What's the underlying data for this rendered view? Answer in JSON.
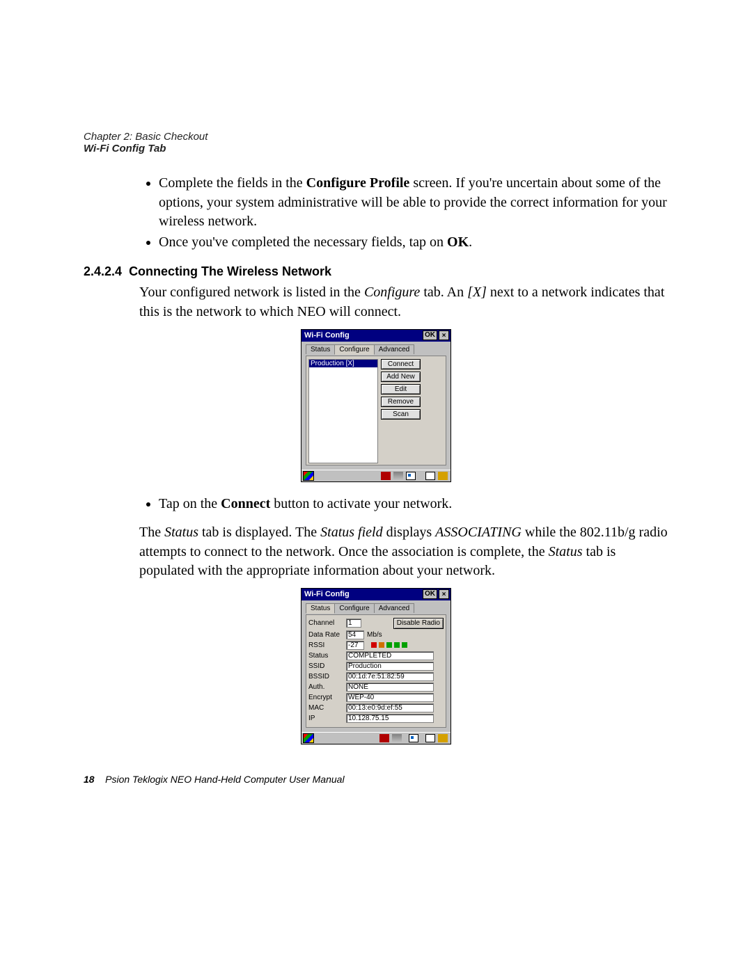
{
  "header": {
    "chapter": "Chapter 2: Basic Checkout",
    "sub": "Wi-Fi Config Tab"
  },
  "bullets_intro": {
    "b1_pre": "Complete the fields in the ",
    "b1_bold": "Configure Profile",
    "b1_post": " screen. If you're uncertain about some of the options, your system administrative will be able to provide the correct information for your wireless network.",
    "b2_pre": "Once you've completed the necessary fields, tap on ",
    "b2_bold": "OK",
    "b2_post": "."
  },
  "section": {
    "num": "2.4.2.4",
    "title": "Connecting The Wireless Network"
  },
  "para1": {
    "a": "Your configured network is listed in the ",
    "i1": "Configure",
    "b": " tab. An ",
    "i2": "[X]",
    "c": " next to a network indicates that this is the network to which NEO will connect."
  },
  "configure_dialog": {
    "title": "Wi-Fi Config",
    "ok": "OK",
    "tabs": [
      "Status",
      "Configure",
      "Advanced"
    ],
    "list_item": "Production [X]",
    "buttons": [
      "Connect",
      "Add New",
      "Edit",
      "Remove",
      "Scan"
    ]
  },
  "bullet_connect": {
    "pre": "Tap on the ",
    "bold": "Connect",
    "post": " button to activate your network."
  },
  "para2": {
    "a": "The ",
    "i1": "Status",
    "b": " tab is displayed. The ",
    "i2": "Status field",
    "c": " displays ",
    "i3": "ASSOCIATING",
    "d": " while the 802.11b/g radio attempts to connect to the network. Once the association is complete, the ",
    "i4": "Status",
    "e": " tab is populated with the appropriate information about your network."
  },
  "status_dialog": {
    "title": "Wi-Fi Config",
    "ok": "OK",
    "tabs": [
      "Status",
      "Configure",
      "Advanced"
    ],
    "disable_btn": "Disable Radio",
    "rows": {
      "channel_label": "Channel",
      "channel_val": "1",
      "rate_label": "Data Rate",
      "rate_val": "54",
      "rate_unit": "Mb/s",
      "rssi_label": "RSSI",
      "rssi_val": "-27",
      "status_label": "Status",
      "status_val": "COMPLETED",
      "ssid_label": "SSID",
      "ssid_val": "Production",
      "bssid_label": "BSSID",
      "bssid_val": "00:1d:7e:51:82:59",
      "auth_label": "Auth.",
      "auth_val": "NONE",
      "encrypt_label": "Encrypt",
      "encrypt_val": "WEP-40",
      "mac_label": "MAC",
      "mac_val": "00:13:e0:9d:ef:55",
      "ip_label": "IP",
      "ip_val": "10.128.75.15"
    },
    "bar_colors": [
      "#d00000",
      "#d07000",
      "#00a000",
      "#00a000",
      "#00a000"
    ]
  },
  "footer": {
    "page": "18",
    "text": "Psion Teklogix NEO Hand-Held Computer User Manual"
  }
}
